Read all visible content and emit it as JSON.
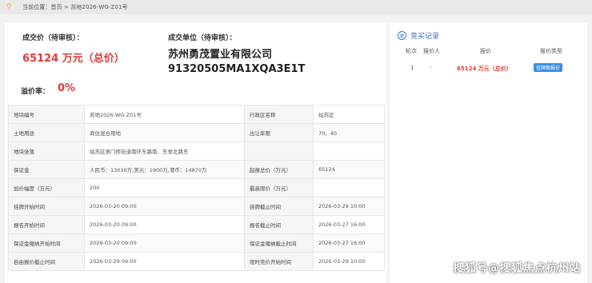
{
  "breadcrumb": {
    "text": "当前位置：首页 > 苏地2026-WG-Z01号"
  },
  "summary": {
    "deal_price_label": "成交价（待审核）：",
    "deal_price_value": "65124 万元（总价）",
    "deal_unit_label": "成交单位（待审核）：",
    "company_name": "苏州勇茂置业有限公司",
    "company_code": "91320505MA1XQA3E1T",
    "premium_label": "溢价率：",
    "premium_value": "0%"
  },
  "info_rows": [
    {
      "k1": "地块编号",
      "v1": "苏地2026-WG-Z01号",
      "k2": "行政区名称",
      "v2": "姑苏区"
    },
    {
      "k1": "土地用途",
      "v1": "商住混合用地",
      "k2": "出让年限",
      "v2": "70、40"
    },
    {
      "k1": "地块坐落",
      "v1": "姑苏区吴门桥街道南环东路南、东吴北路东",
      "k2": "",
      "v2": ""
    },
    {
      "k1": "保证金",
      "v1": "人民币：13030万,美元：1900万,港币：14870万",
      "k2": "起报总价（万元）",
      "v2": "65124"
    },
    {
      "k1": "加价幅度（万元）",
      "v1": "200",
      "k2": "最高限价（万元）",
      "v2": ""
    },
    {
      "k1": "挂牌开始时间",
      "v1": "2026-03-20 09:00",
      "k2": "挂牌截止时间",
      "v2": "2026-03-29 10:00"
    },
    {
      "k1": "报名开始时间",
      "v1": "2026-03-20 09:00",
      "k2": "报名截止时间",
      "v2": "2026-03-27 16:00"
    },
    {
      "k1": "保证金缴纳开始时间",
      "v1": "2026-03-20 09:00",
      "k2": "保证金缴纳截止时间",
      "v2": "2026-03-27 16:00"
    },
    {
      "k1": "自由报价截止时间",
      "v1": "2026-03-29 09:00",
      "k2": "限时竞价开始时间",
      "v2": "2026-03-29 10:00"
    }
  ],
  "record": {
    "title": "竞买记录",
    "headers": {
      "round": "轮次",
      "bidder": "报价人",
      "price": "报价",
      "type": "报价类型"
    },
    "rows": [
      {
        "round": "1",
        "bidder": "-",
        "price": "65124 万元（总价）",
        "type": "挂牌期报价"
      }
    ]
  },
  "watermark": "搜狐号@搜狐焦点杭州站",
  "colors": {
    "accent_red": "#e53935",
    "accent_blue": "#3a78c3"
  }
}
